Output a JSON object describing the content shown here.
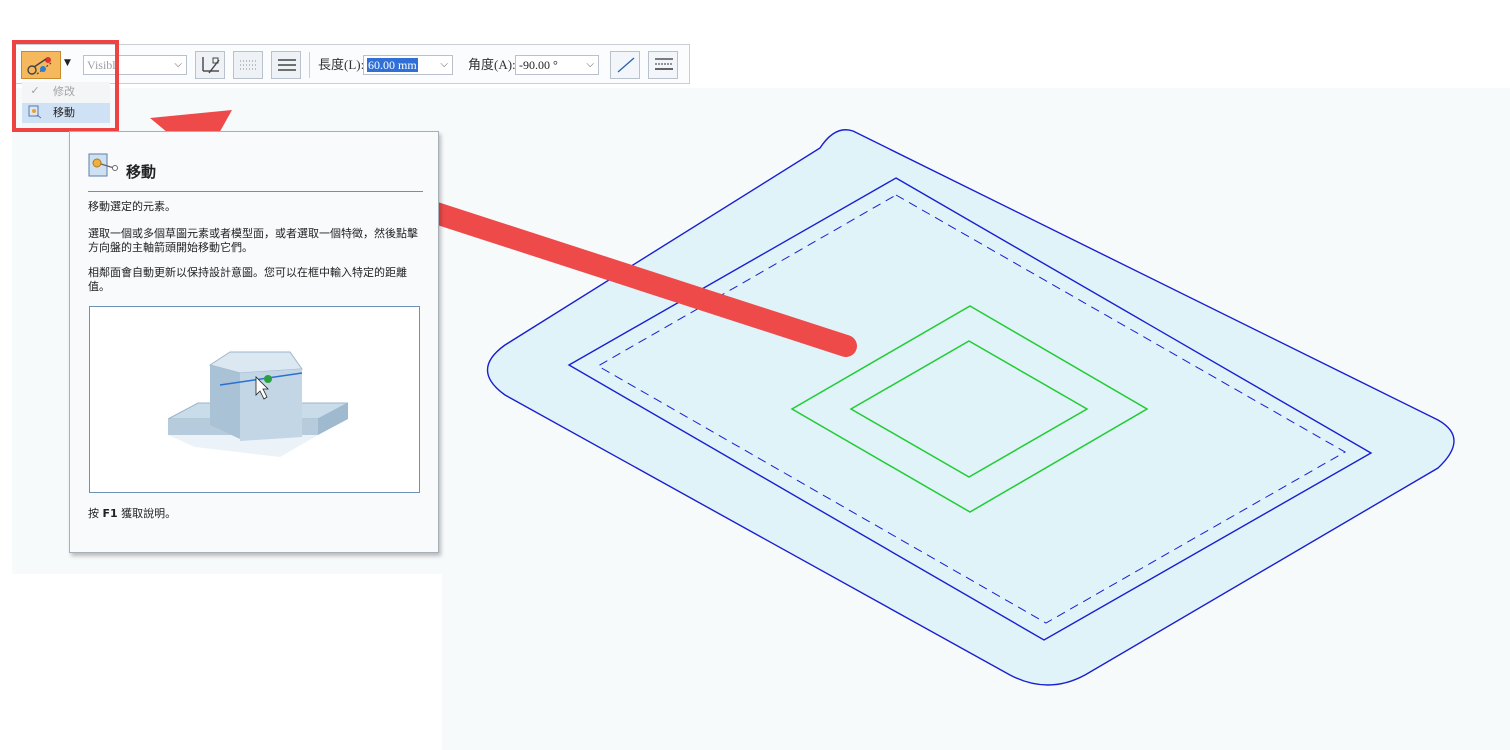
{
  "toolbar": {
    "mode_button_icon": "move-tool-icon",
    "linestyle_value": "Visibl",
    "length_label": "長度(L):",
    "length_value": "60.00 mm",
    "angle_label": "角度(A):",
    "angle_value": "-90.00 °"
  },
  "menu": {
    "items": [
      {
        "label": "修改",
        "icon": "checkmark-icon",
        "enabled": false
      },
      {
        "label": "移動",
        "icon": "move-icon",
        "enabled": true,
        "selected": true
      }
    ]
  },
  "tooltip": {
    "title": "移動",
    "p1": "移動選定的元素。",
    "p2": "選取一個或多個草圖元素或者模型面，或者選取一個特徵，然後點擊方向盤的主軸箭頭開始移動它們。",
    "p3": "相鄰面會自動更新以保持設計意圖。您可以在框中輸入特定的距離值。",
    "footer_prefix": "按",
    "footer_key": "F1",
    "footer_suffix": "獲取說明。"
  },
  "colors": {
    "highlight": "#ee4343",
    "arrow": "#ef4a4a",
    "sketch_blue": "#1a1fd0",
    "sketch_green": "#22cc33",
    "region_fill": "#dff3f8",
    "menu_selected": "#cfe1f5"
  }
}
